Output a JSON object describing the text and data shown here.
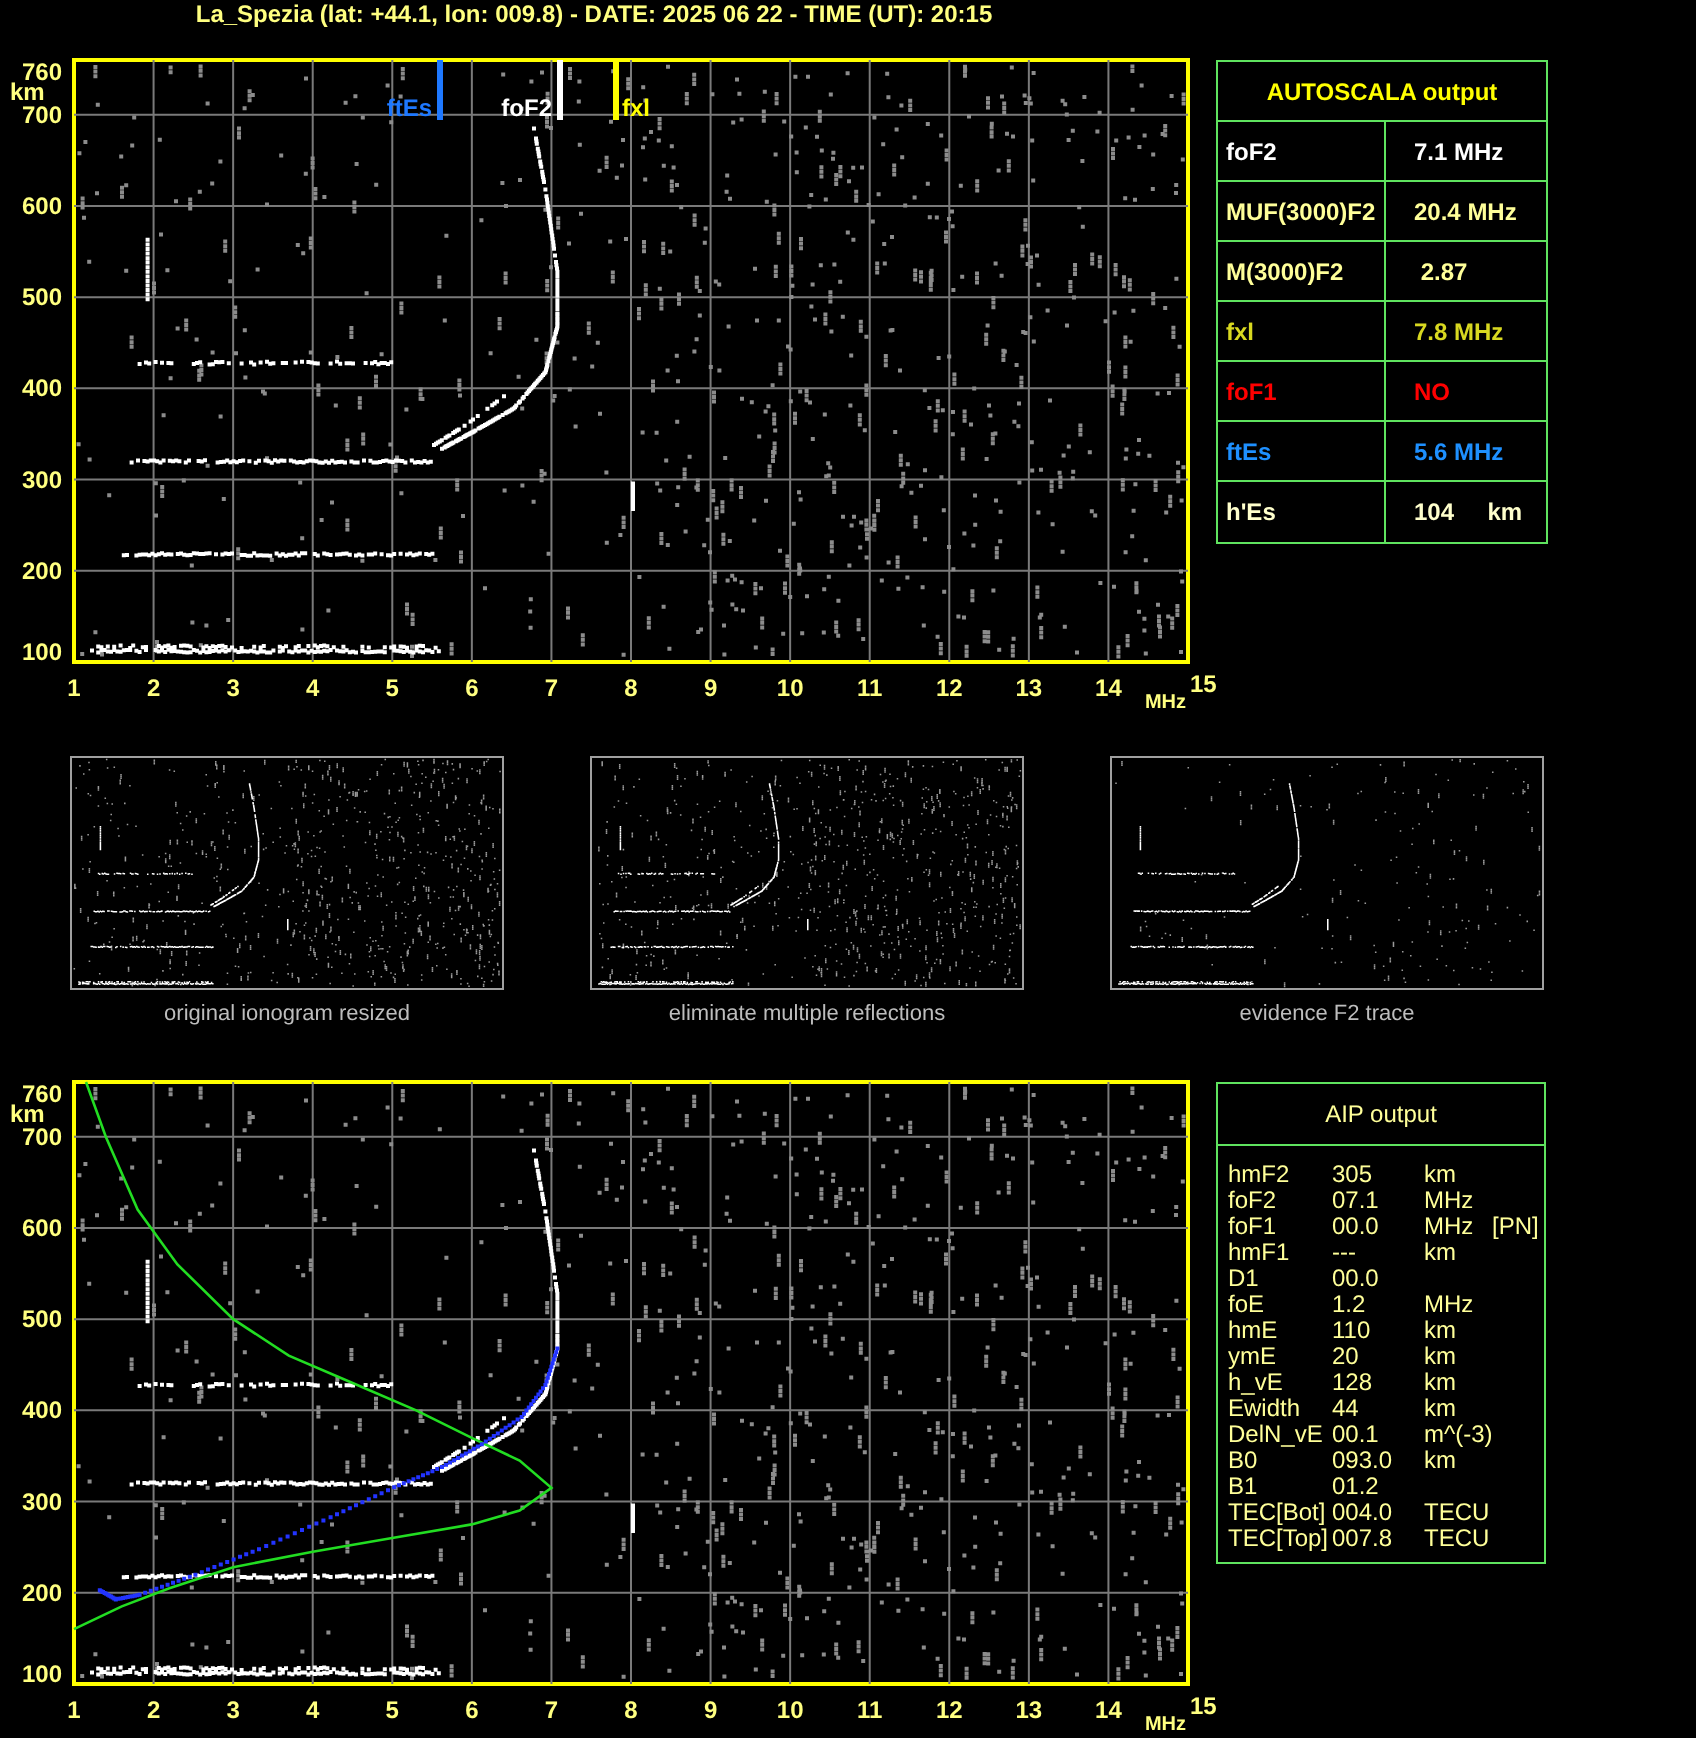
{
  "title": "La_Spezia (lat: +44.1, lon: 009.8) - DATE: 2025 06 22 - TIME (UT): 20:15",
  "ionogram": {
    "y_unit": "km",
    "x_unit": "MHz",
    "y_ticks": [
      "760",
      "700",
      "600",
      "500",
      "400",
      "300",
      "200",
      "100"
    ],
    "x_ticks": [
      "1",
      "2",
      "3",
      "4",
      "5",
      "6",
      "7",
      "8",
      "9",
      "10",
      "11",
      "12",
      "13",
      "14",
      "15"
    ],
    "markers": [
      {
        "label": "ftEs",
        "color": "#1e78ff"
      },
      {
        "label": "foF2",
        "color": "#ffffff"
      },
      {
        "label": "fxl",
        "color": "#ffff00"
      }
    ]
  },
  "autoscala": {
    "title": "AUTOSCALA output",
    "rows": [
      {
        "label": "foF2",
        "value": "7.1 MHz",
        "color": "#ffffff"
      },
      {
        "label": "MUF(3000)F2",
        "value": "20.4 MHz",
        "color": "#ffff99"
      },
      {
        "label": "M(3000)F2",
        "value": " 2.87",
        "color": "#ffff99"
      },
      {
        "label": "fxl",
        "value": "7.8 MHz",
        "color": "#d8d820"
      },
      {
        "label": "foF1",
        "value": "NO",
        "color": "#ff0000"
      },
      {
        "label": "ftEs",
        "value": "5.6 MHz",
        "color": "#1e90ff"
      },
      {
        "label": "h'Es",
        "value": "104     km",
        "color": "#ffffcc"
      }
    ]
  },
  "thumbnails": [
    {
      "caption": "original ionogram resized"
    },
    {
      "caption": "eliminate multiple reflections"
    },
    {
      "caption": "evidence F2 trace"
    }
  ],
  "aip_ionogram": {
    "y_unit": "km",
    "x_unit": "MHz",
    "y_ticks": [
      "760",
      "700",
      "600",
      "500",
      "400",
      "300",
      "200",
      "100"
    ],
    "x_ticks": [
      "1",
      "2",
      "3",
      "4",
      "5",
      "6",
      "7",
      "8",
      "9",
      "10",
      "11",
      "12",
      "13",
      "14",
      "15"
    ]
  },
  "aip": {
    "title": "AIP output",
    "rows": [
      {
        "name": "hmF2",
        "value": "305",
        "unit": "km"
      },
      {
        "name": "foF2",
        "value": "07.1",
        "unit": "MHz"
      },
      {
        "name": "foF1",
        "value": "00.0",
        "unit": "MHz",
        "note": "[PN]"
      },
      {
        "name": "hmF1",
        "value": "---",
        "unit": "km"
      },
      {
        "name": "D1",
        "value": "00.0"
      },
      {
        "name": "foE",
        "value": "1.2",
        "unit": "MHz"
      },
      {
        "name": "hmE",
        "value": "110",
        "unit": "km"
      },
      {
        "name": "ymE",
        "value": "20",
        "unit": "km"
      },
      {
        "name": "h_vE",
        "value": "128",
        "unit": "km"
      },
      {
        "name": "Ewidth",
        "value": "44",
        "unit": "km"
      },
      {
        "name": "DelN_vE",
        "value": "00.1",
        "unit": "m^(-3)"
      },
      {
        "name": "B0",
        "value": "093.0",
        "unit": "km"
      },
      {
        "name": "B1",
        "value": "01.2"
      },
      {
        "name": "TEC[Bot]",
        "value": "004.0",
        "unit": "TECU"
      },
      {
        "name": "TEC[Top]",
        "value": "007.8",
        "unit": "TECU"
      }
    ]
  }
}
